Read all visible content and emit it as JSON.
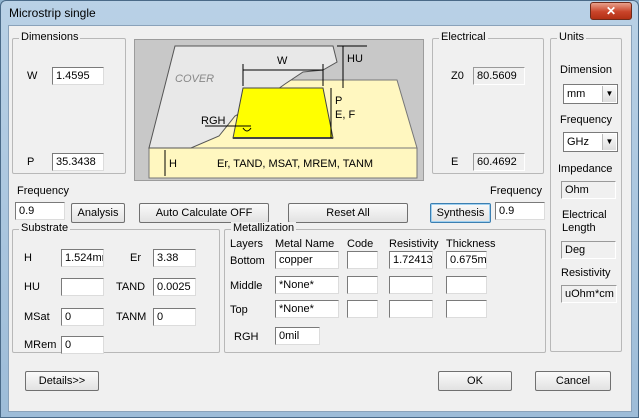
{
  "window": {
    "title": "Microstrip single",
    "close": "✕"
  },
  "dimensions": {
    "title": "Dimensions",
    "w_label": "W",
    "w_value": "1.4595",
    "p_label": "P",
    "p_value": "35.3438"
  },
  "diagram": {
    "cover": "COVER",
    "w": "W",
    "hu": "HU",
    "pef": "P\nE, F",
    "p": "P",
    "ef": "E, F",
    "rgh": "RGH",
    "h": "H",
    "params": "Er, TAND, MSAT, MREM, TANM"
  },
  "electrical": {
    "title": "Electrical",
    "z0_label": "Z0",
    "z0_value": "80.5609",
    "e_label": "E",
    "e_value": "60.4692"
  },
  "units": {
    "title": "Units",
    "dimension_label": "Dimension",
    "dimension_value": "mm",
    "frequency_label": "Frequency",
    "frequency_value": "GHz",
    "impedance_label": "Impedance",
    "impedance_value": "Ohm",
    "elec_length_label1": "Electrical",
    "elec_length_label2": "Length",
    "elec_length_value": "Deg",
    "resistivity_label": "Resistivity",
    "resistivity_value": "uOhm*cm"
  },
  "controls": {
    "freq_left_label": "Frequency",
    "freq_left_value": "0.9",
    "analysis": "Analysis",
    "auto_calc": "Auto Calculate OFF",
    "reset_all": "Reset   All",
    "synthesis": "Synthesis",
    "freq_right_label": "Frequency",
    "freq_right_value": "0.9"
  },
  "substrate": {
    "title": "Substrate",
    "h_label": "H",
    "h_value": "1.524mm",
    "er_label": "Er",
    "er_value": "3.38",
    "hu_label": "HU",
    "hu_value": "",
    "tand_label": "TAND",
    "tand_value": "0.0025",
    "msat_label": "MSat",
    "msat_value": "0",
    "tanm_label": "TANM",
    "tanm_value": "0",
    "mrem_label": "MRem",
    "mrem_value": "0"
  },
  "metallization": {
    "title": "Metallization",
    "headers": {
      "layers": "Layers",
      "metal_name": "Metal Name",
      "code": "Code",
      "resistivity": "Resistivity",
      "thickness": "Thickness"
    },
    "rows": [
      {
        "layer": "Bottom",
        "name": "copper",
        "code": "",
        "resistivity": "1.72413",
        "thickness": "0.675mil"
      },
      {
        "layer": "Middle",
        "name": "*None*",
        "code": "",
        "resistivity": "",
        "thickness": ""
      },
      {
        "layer": "Top",
        "name": "*None*",
        "code": "",
        "resistivity": "",
        "thickness": ""
      }
    ],
    "rgh_label": "RGH",
    "rgh_value": "0mil"
  },
  "footer": {
    "details": "Details>>",
    "ok": "OK",
    "cancel": "Cancel"
  }
}
